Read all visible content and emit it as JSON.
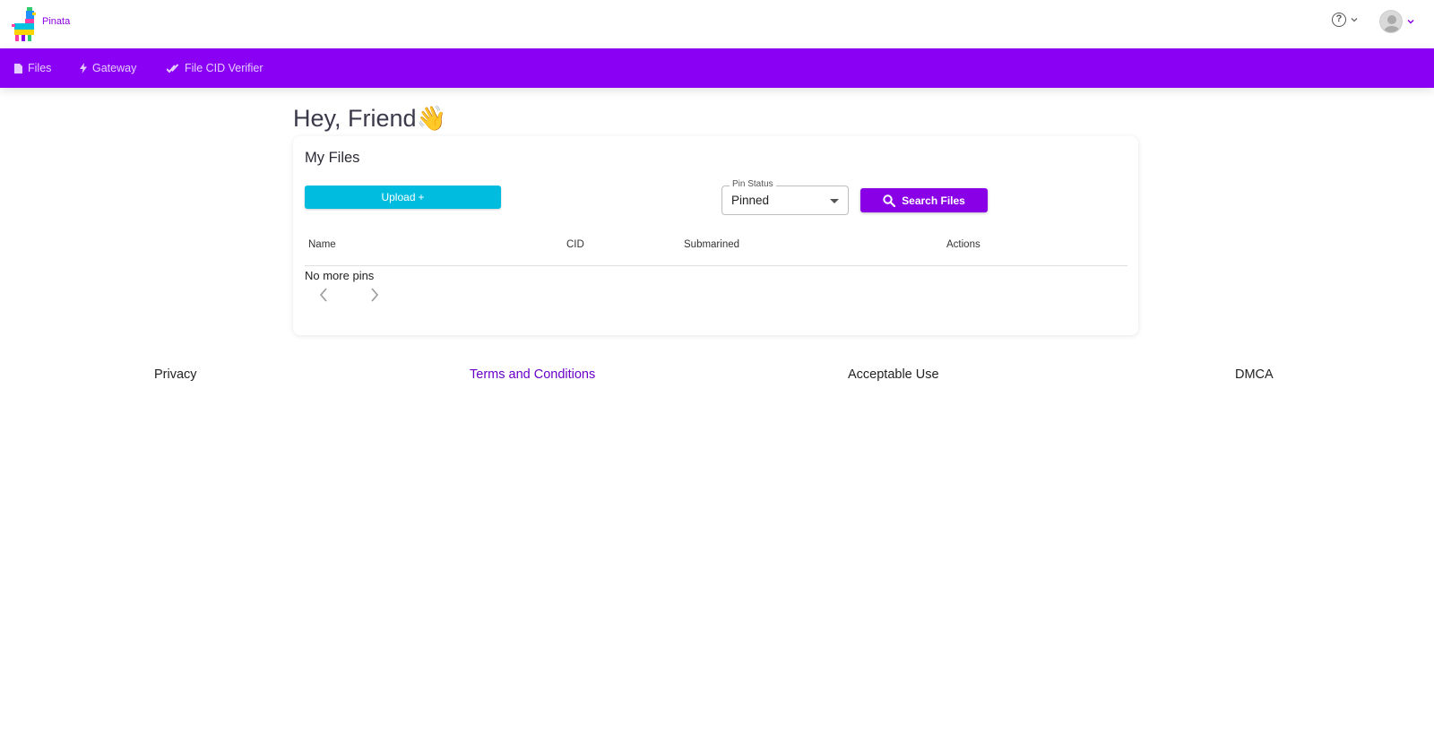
{
  "header": {
    "brand": "Pinata",
    "help_icon": "question-circle-icon",
    "account_icon": "avatar-icon"
  },
  "nav": {
    "items": [
      {
        "label": "Files",
        "icon": "file-icon"
      },
      {
        "label": "Gateway",
        "icon": "bolt-icon"
      },
      {
        "label": "File CID Verifier",
        "icon": "double-check-icon"
      }
    ],
    "color": "#8a00f5"
  },
  "main": {
    "greeting": "Hey, Friend👋",
    "card": {
      "title": "My Files",
      "upload_label": "Upload",
      "upload_suffix": "+",
      "pin_status": {
        "legend": "Pin Status",
        "value": "Pinned"
      },
      "search_label": "Search Files",
      "columns": [
        "Name",
        "CID",
        "Submarined",
        "Actions"
      ],
      "empty_message": "No more pins"
    }
  },
  "footer": {
    "links": [
      "Privacy",
      "Terms and Conditions",
      "Acceptable Use",
      "DMCA"
    ]
  },
  "colors": {
    "accent": "#8a00e6",
    "upload": "#00bcdf",
    "active_link": "#6a00c8"
  }
}
